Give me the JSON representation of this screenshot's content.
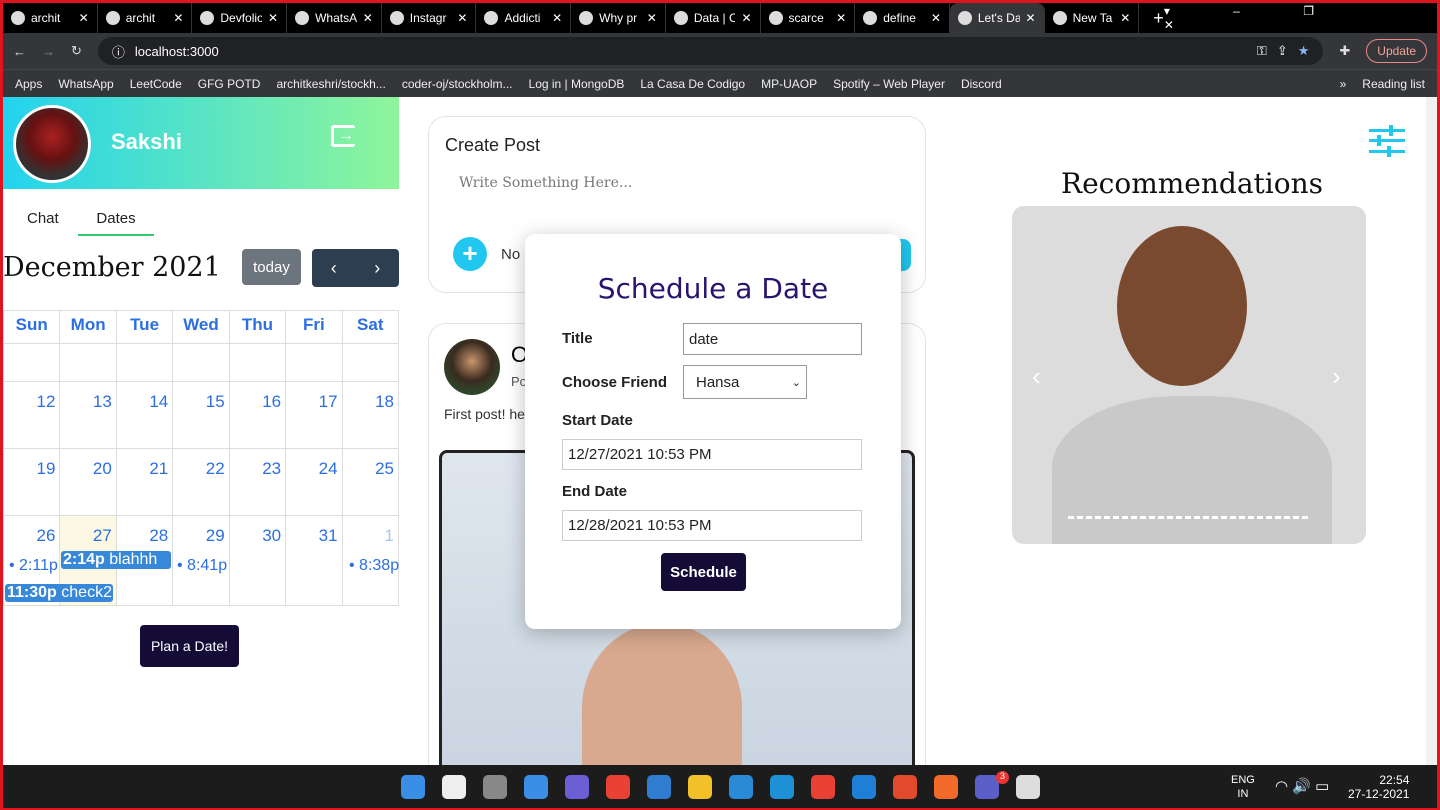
{
  "browser": {
    "tabs": [
      "archit",
      "archit",
      "Devfolio",
      "WhatsA",
      "Instagr",
      "Addicti",
      "Why pr",
      "Data | C",
      "scarce",
      "define",
      "Let's Da",
      "New Ta"
    ],
    "active_tab": 10,
    "url": "localhost:3000",
    "update_label": "Update",
    "bookmarks": [
      "Apps",
      "WhatsApp",
      "LeetCode",
      "GFG POTD",
      "architkeshri/stockh...",
      "coder-oj/stockholm...",
      "Log in | MongoDB",
      "La Casa De Codigo",
      "MP-UAOP",
      "Spotify – Web Player",
      "Discord"
    ],
    "reading_list": "Reading list"
  },
  "profile": {
    "name": "Sakshi"
  },
  "panel_tabs": {
    "chat": "Chat",
    "dates": "Dates"
  },
  "calendar": {
    "title": "December 2021",
    "today_label": "today",
    "prev": "‹",
    "next": "›",
    "days": [
      "Sun",
      "Mon",
      "Tue",
      "Wed",
      "Thu",
      "Fri",
      "Sat"
    ],
    "weeks": [
      [
        "",
        "",
        "",
        "",
        "",
        "",
        ""
      ],
      [
        "12",
        "13",
        "14",
        "15",
        "16",
        "17",
        "18"
      ],
      [
        "19",
        "20",
        "21",
        "22",
        "23",
        "24",
        "25"
      ],
      [
        "26",
        "27",
        "28",
        "29",
        "30",
        "31",
        "1"
      ]
    ],
    "events": {
      "e1": "2:11p",
      "e2_time": "2:14p",
      "e2_title": "blahhh",
      "e3": "8:41p",
      "e4": "8:38p",
      "e5_time": "11:30p",
      "e5_title": "check2"
    },
    "today_color": "#fcf8e3",
    "event_color": "#3788d8"
  },
  "plan_button": "Plan a Date!",
  "create_post": {
    "title": "Create Post",
    "placeholder": "Write Something Here...",
    "no_file": "No"
  },
  "post": {
    "author_initial": "O",
    "sub": "Po",
    "text": "First post! he"
  },
  "modal": {
    "title": "Schedule a Date",
    "title_label": "Title",
    "title_value": "date",
    "friend_label": "Choose Friend",
    "friend_value": "Hansa",
    "start_label": "Start Date",
    "start_value": "12/27/2021 10:53 PM",
    "end_label": "End Date",
    "end_value": "12/28/2021 10:53 PM",
    "submit": "Schedule"
  },
  "recommendations": {
    "title": "Recommendations"
  },
  "taskbar": {
    "lang": "ENG",
    "region": "IN",
    "time": "22:54",
    "date": "27-12-2021",
    "teams_badge": "3"
  }
}
